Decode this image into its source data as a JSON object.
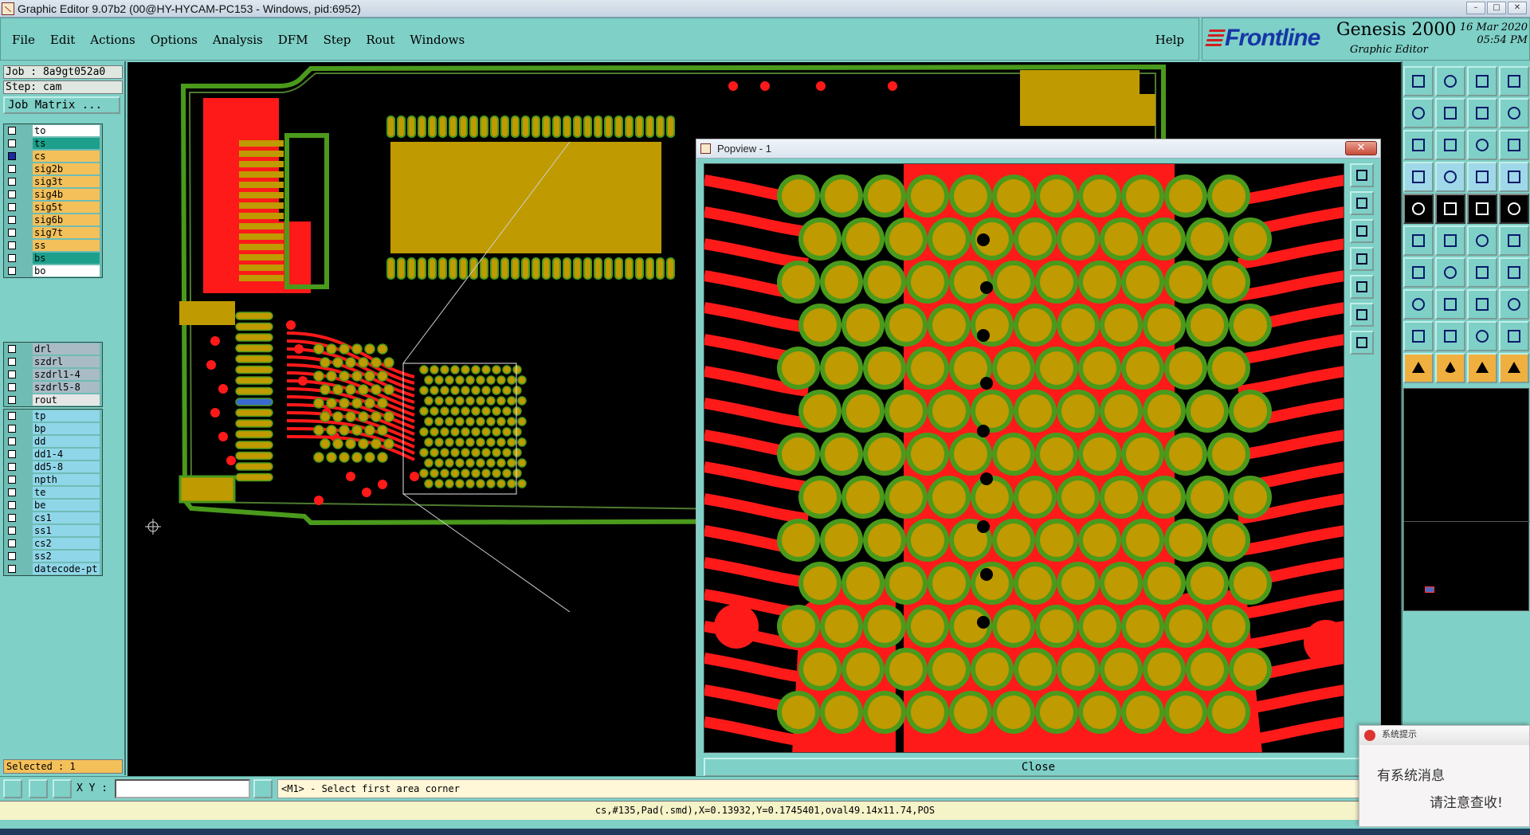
{
  "window": {
    "title": "Graphic Editor 9.07b2 (00@HY-HYCAM-PC153 - Windows, pid:6952)"
  },
  "menu": {
    "items": [
      "File",
      "Edit",
      "Actions",
      "Options",
      "Analysis",
      "DFM",
      "Step",
      "Rout",
      "Windows"
    ],
    "help": "Help"
  },
  "brand": {
    "logo": "Frontline",
    "product": "Genesis 2000",
    "subtitle": "Graphic Editor",
    "date": "16 Mar 2020",
    "time": "05:54 PM"
  },
  "left": {
    "job": "Job : 8a9gt052a0",
    "step": "Step: cam",
    "job_matrix": "Job Matrix ...",
    "selected": "Selected : 1",
    "groups": [
      {
        "layers": [
          {
            "name": "to",
            "color": "#ffffff",
            "checked": false
          },
          {
            "name": "ts",
            "color": "#1ca08c",
            "checked": false
          },
          {
            "name": "cs",
            "color": "#f4c05a",
            "checked": true
          },
          {
            "name": "sig2b",
            "color": "#f4c05a",
            "checked": false
          },
          {
            "name": "sig3t",
            "color": "#f4c05a",
            "checked": false
          },
          {
            "name": "sig4b",
            "color": "#f4c05a",
            "checked": false
          },
          {
            "name": "sig5t",
            "color": "#f4c05a",
            "checked": false
          },
          {
            "name": "sig6b",
            "color": "#f4c05a",
            "checked": false
          },
          {
            "name": "sig7t",
            "color": "#f4c05a",
            "checked": false
          },
          {
            "name": "ss",
            "color": "#f4c05a",
            "checked": false
          },
          {
            "name": "bs",
            "color": "#1ca08c",
            "checked": false
          },
          {
            "name": "bo",
            "color": "#ffffff",
            "checked": false
          }
        ]
      },
      {
        "layers": [
          {
            "name": "drl",
            "color": "#a9bcc6",
            "checked": false
          },
          {
            "name": "szdrl",
            "color": "#a9bcc6",
            "checked": false
          },
          {
            "name": "szdrl1-4",
            "color": "#a9bcc6",
            "checked": false
          },
          {
            "name": "szdrl5-8",
            "color": "#a9bcc6",
            "checked": false
          },
          {
            "name": "rout",
            "color": "#e6e6e6",
            "checked": false
          }
        ]
      },
      {
        "layers": [
          {
            "name": "tp",
            "color": "#8fd6e8",
            "checked": false
          },
          {
            "name": "bp",
            "color": "#8fd6e8",
            "checked": false
          },
          {
            "name": "dd",
            "color": "#8fd6e8",
            "checked": false
          },
          {
            "name": "dd1-4",
            "color": "#8fd6e8",
            "checked": false
          },
          {
            "name": "dd5-8",
            "color": "#8fd6e8",
            "checked": false
          },
          {
            "name": "npth",
            "color": "#8fd6e8",
            "checked": false
          },
          {
            "name": "te",
            "color": "#8fd6e8",
            "checked": false
          },
          {
            "name": "be",
            "color": "#8fd6e8",
            "checked": false
          },
          {
            "name": "cs1",
            "color": "#8fd6e8",
            "checked": false
          },
          {
            "name": "ss1",
            "color": "#8fd6e8",
            "checked": false
          },
          {
            "name": "cs2",
            "color": "#8fd6e8",
            "checked": false
          },
          {
            "name": "ss2",
            "color": "#8fd6e8",
            "checked": false
          },
          {
            "name": "datecode-pt",
            "color": "#8fd6e8",
            "checked": false
          }
        ]
      }
    ]
  },
  "popview": {
    "title": "Popview - 1",
    "close_label": "Close"
  },
  "command": {
    "xy_label": "X Y :",
    "xy_value": "",
    "prompt": "<M1> - Select first area corner"
  },
  "status": {
    "text": "cs,#135,Pad(.smd),X=0.13932,Y=0.1745401,oval49.14x11.74,POS"
  },
  "notify": {
    "title": "系统提示",
    "line1": "有系统消息",
    "line2": "请注意查收!"
  },
  "colors": {
    "copper": "#bf9a00",
    "trace": "#ff1a1a",
    "mask": "#4a9a1c",
    "panel": "#7fd0c7"
  }
}
